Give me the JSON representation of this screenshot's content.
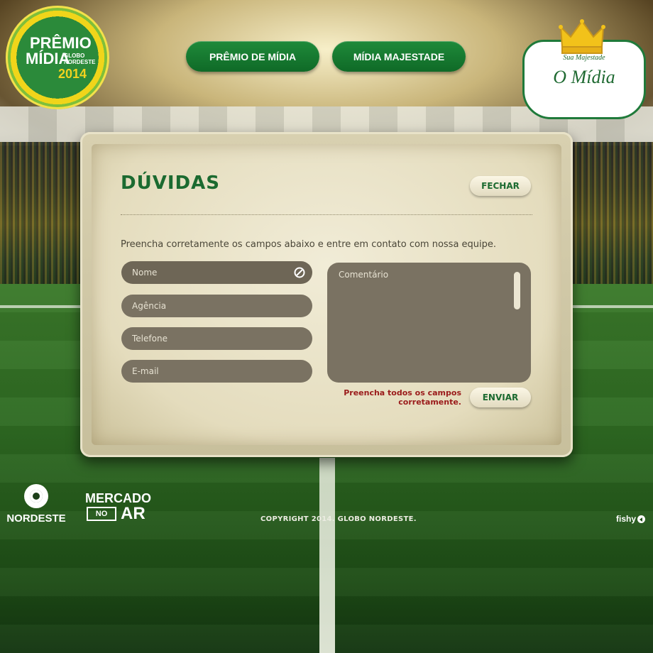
{
  "header": {
    "logo_left": {
      "line1": "PRÊMIO",
      "line2": "MÍDIA",
      "line3a": "GLOBO",
      "line3b": "NORDESTE",
      "year": "2014"
    },
    "nav": [
      {
        "label": "PRÊMIO DE MÍDIA"
      },
      {
        "label": "MÍDIA MAJESTADE"
      }
    ],
    "logo_right": {
      "subtitle": "Sua Majestade",
      "title": "O Mídia"
    }
  },
  "modal": {
    "title": "DÚVIDAS",
    "close_label": "FECHAR",
    "intro": "Preencha corretamente os campos abaixo e entre em contato com nossa equipe.",
    "fields": {
      "name_placeholder": "Nome",
      "agency_placeholder": "Agência",
      "phone_placeholder": "Telefone",
      "email_placeholder": "E-mail",
      "comment_placeholder": "Comentário"
    },
    "error_line1": "Preencha todos os campos",
    "error_line2": "corretamente.",
    "send_label": "ENVIAR",
    "colors": {
      "title": "#1b6a30",
      "error": "#9a1a1a",
      "field_bg": "#7a7262"
    }
  },
  "footer": {
    "globo_word": "NORDESTE",
    "mercado_line1": "MERCADO",
    "mercado_box": "NO",
    "mercado_line2": "AR",
    "copyright": "COPYRIGHT 2014. GLOBO NORDESTE.",
    "credit": "fishy"
  }
}
